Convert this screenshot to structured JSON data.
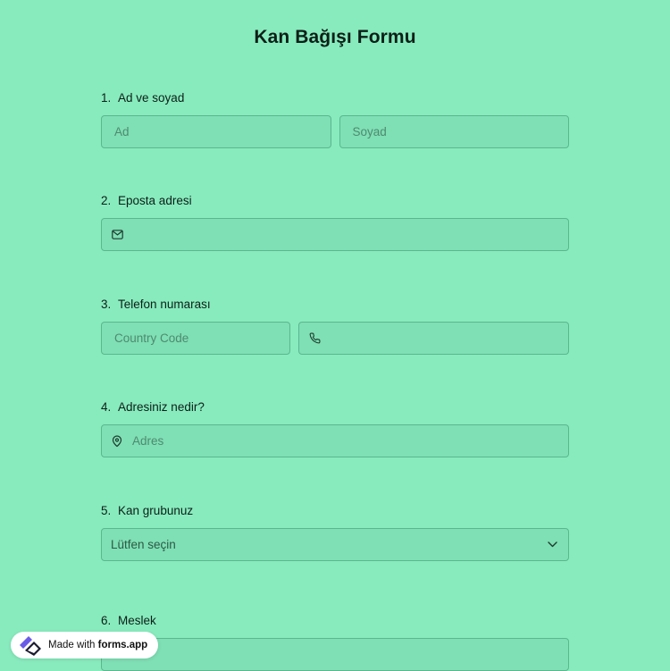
{
  "form": {
    "title": "Kan Bağışı Formu",
    "questions": [
      {
        "number": "1.",
        "label": "Ad ve soyad",
        "first_name_placeholder": "Ad",
        "last_name_placeholder": "Soyad"
      },
      {
        "number": "2.",
        "label": "Eposta adresi",
        "icon": "envelope-icon"
      },
      {
        "number": "3.",
        "label": "Telefon numarası",
        "country_code_placeholder": "Country Code",
        "icon": "phone-icon"
      },
      {
        "number": "4.",
        "label": "Adresiniz nedir?",
        "placeholder": "Adres",
        "icon": "map-pin-icon"
      },
      {
        "number": "5.",
        "label": "Kan grubunuz",
        "select_value": "Lütfen seçin",
        "icon": "chevron-down-icon"
      },
      {
        "number": "6.",
        "label": "Meslek"
      }
    ]
  },
  "badge": {
    "prefix": "Made with ",
    "brand": "forms.app",
    "icon": "forms-app-logo-icon"
  },
  "colors": {
    "background": "#88ebbe",
    "field_fill": "#7fdfb5",
    "field_border": "#5bb78e",
    "text": "#0d1f17"
  }
}
